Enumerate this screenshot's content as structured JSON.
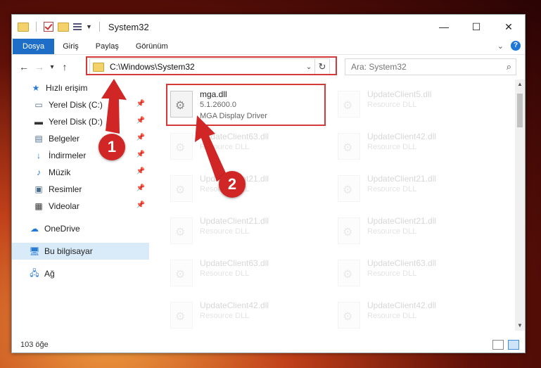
{
  "window": {
    "title": "System32",
    "controls": {
      "minimize": "—",
      "maximize": "☐",
      "close": "✕"
    }
  },
  "ribbon": {
    "tabs": [
      "Dosya",
      "Giriş",
      "Paylaş",
      "Görünüm"
    ],
    "help": "?"
  },
  "navigation": {
    "back": "←",
    "forward": "→",
    "recent": "▾",
    "up": "↑",
    "address": "C:\\Windows\\System32",
    "refresh": "↻",
    "search_placeholder": "Ara: System32"
  },
  "sidebar": {
    "quick_access": "Hızlı erişim",
    "items": [
      {
        "label": "Yerel Disk (C:)",
        "icon": "drive-icon"
      },
      {
        "label": "Yerel Disk (D:)",
        "icon": "drive-icon"
      },
      {
        "label": "Belgeler",
        "icon": "documents-icon"
      },
      {
        "label": "İndirmeler",
        "icon": "downloads-icon"
      },
      {
        "label": "Müzik",
        "icon": "music-icon"
      },
      {
        "label": "Resimler",
        "icon": "pictures-icon"
      },
      {
        "label": "Videolar",
        "icon": "videos-icon"
      }
    ],
    "onedrive": "OneDrive",
    "this_pc": "Bu bilgisayar",
    "network": "Ağ"
  },
  "files": [
    {
      "name": "mga.dll",
      "version": "5.1.2600.0",
      "description": "MGA Display Driver",
      "highlighted": true
    },
    {
      "name": "UpdateClient5.dll",
      "description": "Resource DLL"
    },
    {
      "name": "UpdateClient63.dll",
      "description": "Resource DLL"
    },
    {
      "name": "UpdateClient42.dll",
      "description": "Resource DLL"
    },
    {
      "name": "UpdateClient21.dll",
      "description": "Resource DLL"
    },
    {
      "name": "UpdateClient21.dll",
      "description": "Resource DLL"
    },
    {
      "name": "UpdateClient21.dll",
      "description": "Resource DLL"
    },
    {
      "name": "UpdateClient21.dll",
      "description": "Resource DLL"
    },
    {
      "name": "UpdateClient63.dll",
      "description": "Resource DLL"
    },
    {
      "name": "UpdateClient63.dll",
      "description": "Resource DLL"
    },
    {
      "name": "UpdateClient42.dll",
      "description": "Resource DLL"
    },
    {
      "name": "UpdateClient42.dll",
      "description": "Resource DLL"
    }
  ],
  "annotations": {
    "step1": "1",
    "step2": "2"
  },
  "status": {
    "item_count": "103 öğe"
  },
  "colors": {
    "accent": "#1e6ec8",
    "highlight": "#d43a3a",
    "selection": "#d9ebf9"
  }
}
